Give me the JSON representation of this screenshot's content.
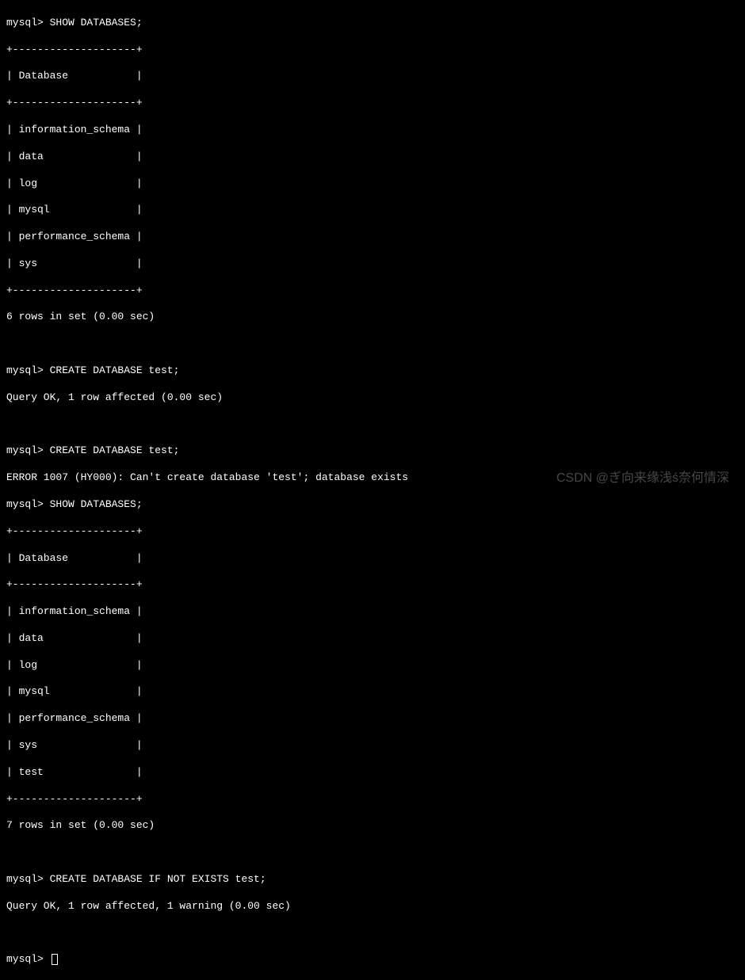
{
  "prompt": "mysql> ",
  "commands": {
    "show_db1": "SHOW DATABASES;",
    "create_db1": "CREATE DATABASE test;",
    "create_db2": "CREATE DATABASE test;",
    "show_db2": "SHOW DATABASES;",
    "create_if_not_exists": "CREATE DATABASE IF NOT EXISTS test;"
  },
  "table1": {
    "border": "+--------------------+",
    "header": "| Database           |",
    "rows": [
      "| information_schema |",
      "| data               |",
      "| log                |",
      "| mysql              |",
      "| performance_schema |",
      "| sys                |"
    ],
    "footer": "6 rows in set (0.00 sec)"
  },
  "table2": {
    "border": "+--------------------+",
    "header": "| Database           |",
    "rows": [
      "| information_schema |",
      "| data               |",
      "| log                |",
      "| mysql              |",
      "| performance_schema |",
      "| sys                |",
      "| test               |"
    ],
    "footer": "7 rows in set (0.00 sec)"
  },
  "responses": {
    "query_ok1": "Query OK, 1 row affected (0.00 sec)",
    "error1007": "ERROR 1007 (HY000): Can't create database 'test'; database exists",
    "query_ok_warning": "Query OK, 1 row affected, 1 warning (0.00 sec)"
  },
  "watermark": "CSDN @ぎ向来缘浅ś奈何情深"
}
